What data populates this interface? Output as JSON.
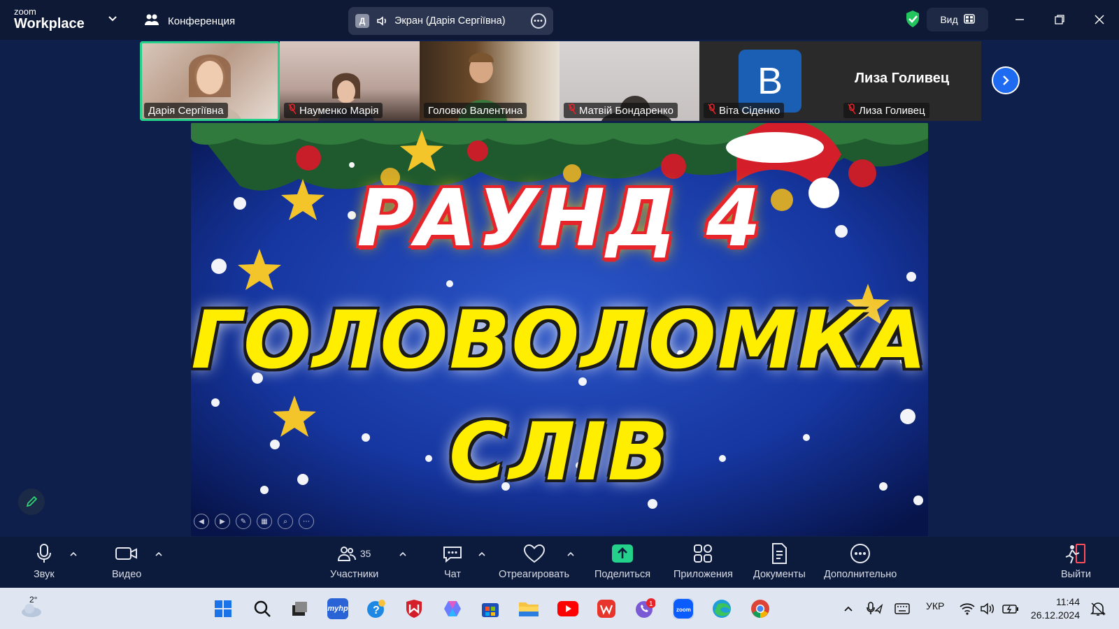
{
  "app": {
    "logo_small": "zoom",
    "logo_big": "Workplace",
    "meeting_label": "Конференция",
    "share_badge": "Д",
    "share_label": "Экран (Дарія Сергіївна)",
    "view_label": "Вид"
  },
  "participants": [
    {
      "name": "Дарія Сергіївна",
      "muted": false,
      "active": true
    },
    {
      "name": "Науменко Марія",
      "muted": true
    },
    {
      "name": "Головко Валентина",
      "muted": false
    },
    {
      "name": "Матвій Бондаренко",
      "muted": true
    },
    {
      "name": "Віта Сіденко",
      "muted": true,
      "avatar_letter": "B"
    },
    {
      "name": "Лиза Голивец",
      "muted": true,
      "display_name": "Лиза Голивец"
    }
  ],
  "slide": {
    "line1": "РАУНД 4",
    "line2": "ГОЛОВОЛОМКА",
    "line3": "СЛІВ"
  },
  "toolbar": {
    "audio": "Звук",
    "video": "Видео",
    "participants": "Участники",
    "participants_count": "35",
    "chat": "Чат",
    "react": "Отреагировать",
    "share": "Поделиться",
    "apps": "Приложения",
    "docs": "Документы",
    "more": "Дополнительно",
    "leave": "Выйти"
  },
  "taskbar": {
    "weather": "2°",
    "lang": "УКР",
    "time": "11:44",
    "date": "26.12.2024",
    "viber_badge": "1"
  },
  "colors": {
    "active_speaker": "#23d18b",
    "share_green": "#23d18b",
    "next_blue": "#1e6bf2",
    "muted_red": "#e8242b"
  }
}
